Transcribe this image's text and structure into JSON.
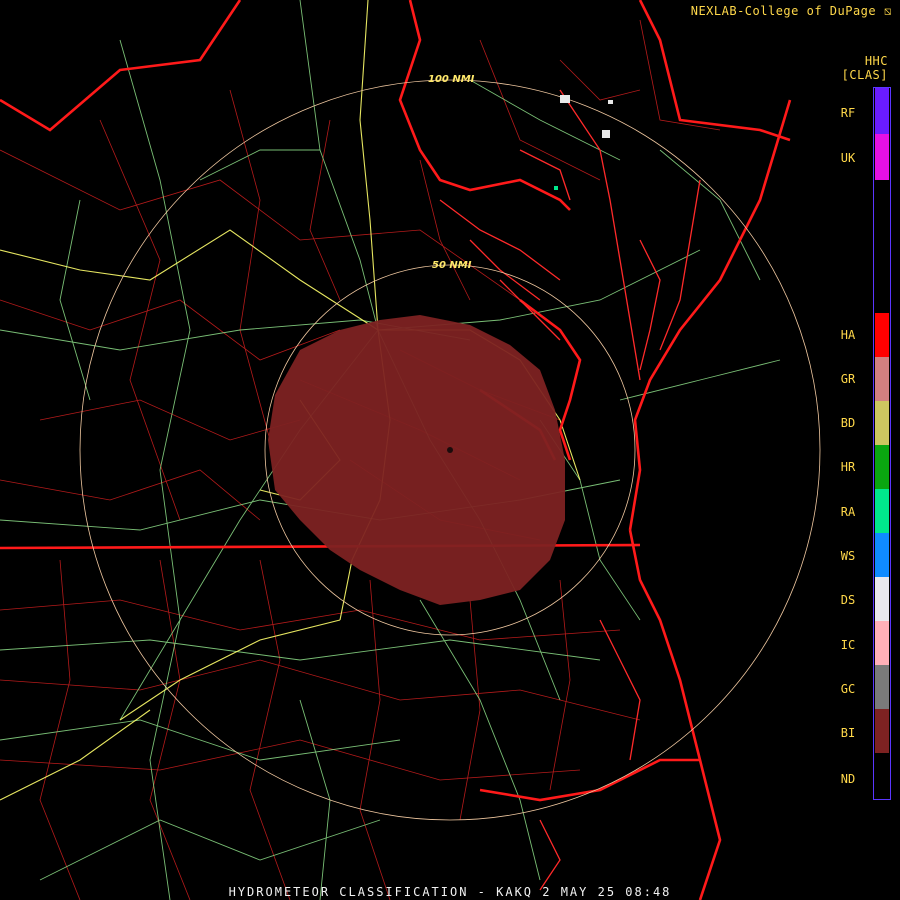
{
  "credit": "NEXLAB-College of DuPage",
  "product": {
    "code": "HHC",
    "sub": "[CLAS]"
  },
  "rings": [
    "100 NMI",
    "50 NMI"
  ],
  "legend": [
    {
      "code": "RF",
      "color": "#6a1cff"
    },
    {
      "code": "UK",
      "color": "#e510e5"
    },
    {
      "code": "HA",
      "color": "#ff0000"
    },
    {
      "code": "GR",
      "color": "#d18080"
    },
    {
      "code": "BD",
      "color": "#cdc660"
    },
    {
      "code": "HR",
      "color": "#0aa610"
    },
    {
      "code": "RA",
      "color": "#00e88c"
    },
    {
      "code": "WS",
      "color": "#0f8bff"
    },
    {
      "code": "DS",
      "color": "#e9e9ee"
    },
    {
      "code": "IC",
      "color": "#ffb0b8"
    },
    {
      "code": "GC",
      "color": "#7a7a7a"
    },
    {
      "code": "BI",
      "color": "#7d2222"
    },
    {
      "code": "ND",
      "color": "#000000"
    }
  ],
  "footer": "HYDROMETEOR CLASSIFICATION - KAKQ 2 MAY 25 08:48"
}
